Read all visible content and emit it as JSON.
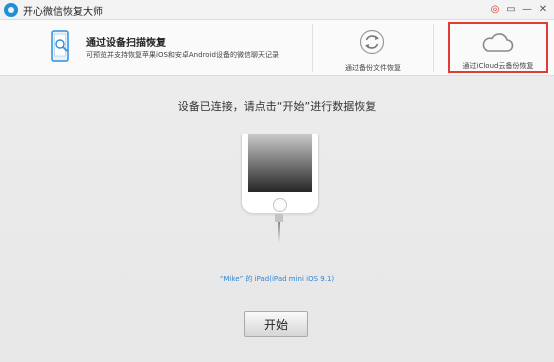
{
  "window": {
    "title": "开心微信恢复大师",
    "controls": {
      "weibo_icon": "weibo-icon",
      "menu_icon": "menu-icon",
      "minimize_icon": "minimize-icon",
      "close_icon": "close-icon",
      "weibo_glyph": "◎",
      "menu_glyph": "▭",
      "minimize_glyph": "—",
      "close_glyph": "✕"
    }
  },
  "tabs": {
    "scan": {
      "title": "通过设备扫描恢复",
      "description": "可预览并支持恢复苹果iOS和安卓Android设备的微信聊天记录",
      "icon": "phone-magnifier-icon"
    },
    "backup": {
      "label": "通过备份文件恢复",
      "icon": "refresh-icon"
    },
    "icloud": {
      "label": "通过iCloud云备份恢复",
      "icon": "cloud-icon",
      "highlight_color": "#e23b35"
    }
  },
  "main": {
    "instruction": "设备已连接，请点击“开始”进行数据恢复",
    "device_info": "“Mike” 的 iPad(iPad mini iOS 9.1)",
    "device_icon": "ipad-device-icon",
    "start_button_label": "开始"
  },
  "colors": {
    "accent_blue": "#2e86d4",
    "background": "#ececec"
  }
}
